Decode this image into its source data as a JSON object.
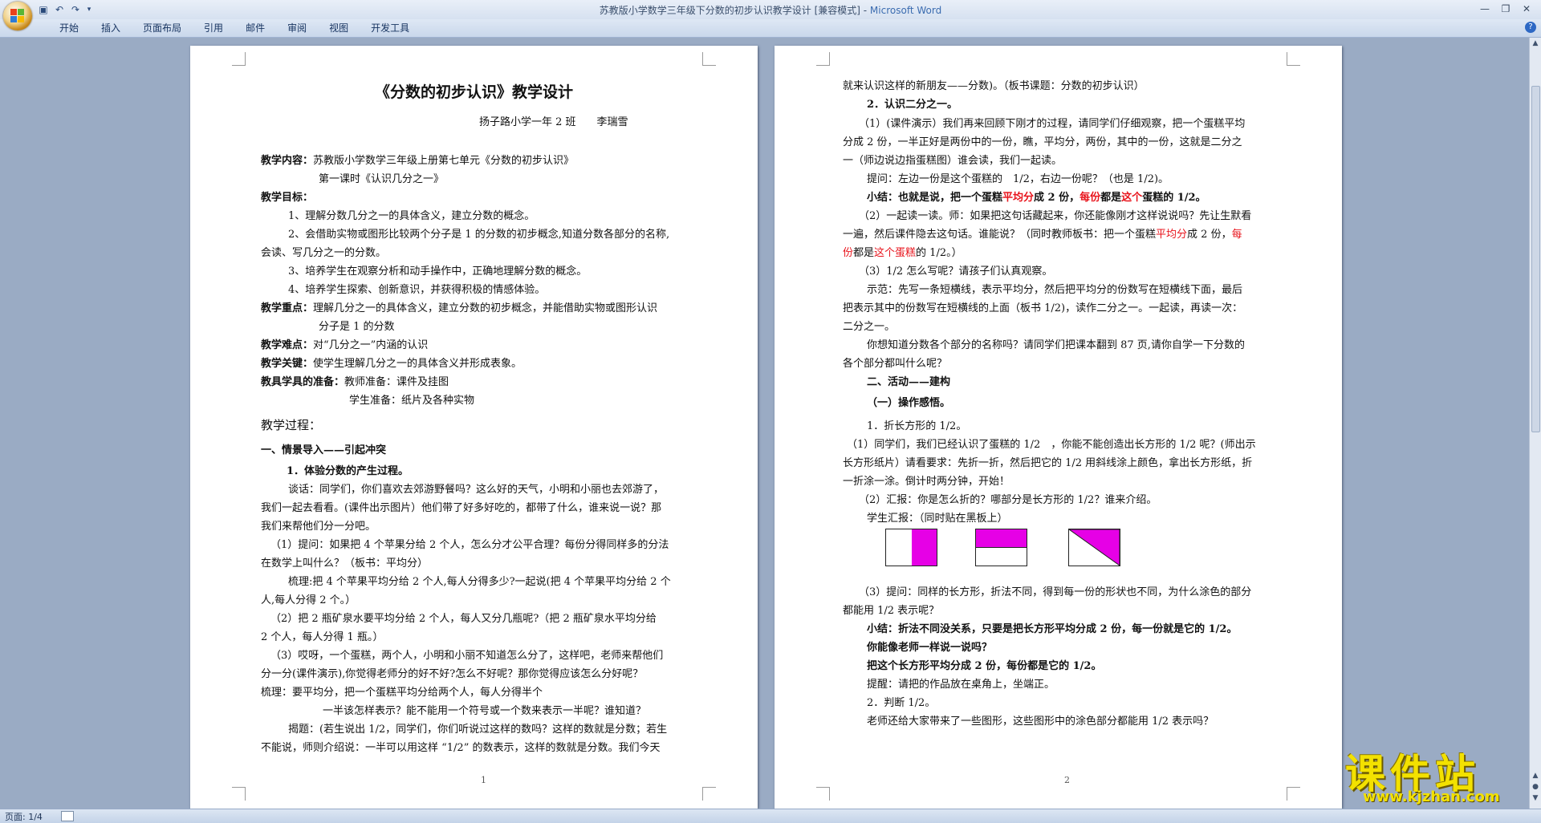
{
  "window": {
    "doc_name": "苏教版小学数学三年级下分数的初步认识教学设计 [兼容模式] - ",
    "app_name": "Microsoft Word"
  },
  "qat": {
    "save_icon": "save-icon",
    "undo_icon": "undo-icon",
    "redo_icon": "redo-icon"
  },
  "ribbon_tabs": [
    "开始",
    "插入",
    "页面布局",
    "引用",
    "邮件",
    "审阅",
    "视图",
    "开发工具"
  ],
  "statusbar": {
    "page_info": "页面: 1/4"
  },
  "page1": {
    "number": "1",
    "title": "《分数的初步认识》教学设计",
    "author": "扬子路小学一年 2 班　　李瑞雪",
    "lines": [
      {
        "label": "教学内容：",
        "text": "苏教版小学数学三年级上册第七单元《分数的初步认识》"
      },
      {
        "label": "",
        "text": "第一课时《认识几分之一》"
      },
      {
        "label": "教学目标：",
        "text": ""
      },
      {
        "label": "",
        "text": "1、理解分数几分之一的具体含义，建立分数的概念。"
      },
      {
        "label": "",
        "text": "2、会借助实物或图形比较两个分子是 1 的分数的初步概念,知道分数各部分的名称,"
      },
      {
        "label": "",
        "text": "会读、写几分之一的分数。"
      },
      {
        "label": "",
        "text": "3、培养学生在观察分析和动手操作中，正确地理解分数的概念。"
      },
      {
        "label": "",
        "text": "4、培养学生探索、创新意识，并获得积极的情感体验。"
      },
      {
        "label": "教学重点：",
        "text": "理解几分之一的具体含义，建立分数的初步概念，并能借助实物或图形认识"
      },
      {
        "label": "",
        "text": "分子是 1 的分数"
      },
      {
        "label": "教学难点：",
        "text": "对“几分之一”内涵的认识"
      },
      {
        "label": "教学关键：",
        "text": "使学生理解几分之一的具体含义并形成表象。"
      },
      {
        "label": "教具学具的准备：",
        "text": "教师准备：课件及挂图"
      },
      {
        "label": "",
        "text": "学生准备：纸片及各种实物"
      },
      {
        "label": "",
        "text": "教学过程："
      },
      {
        "label": "",
        "text": "一、情景导入——引起冲突"
      },
      {
        "label": "",
        "text": "1．体验分数的产生过程。"
      },
      {
        "label": "",
        "text": "谈话：同学们，你们喜欢去郊游野餐吗？这么好的天气，小明和小丽也去郊游了，"
      },
      {
        "label": "",
        "text": "我们一起去看看。(课件出示图片）他们带了好多好吃的，都带了什么，谁来说一说？那"
      },
      {
        "label": "",
        "text": "我们来帮他们分一分吧。"
      },
      {
        "label": "",
        "text": "（1）提问：如果把 4 个苹果分给 2 个人，怎么分才公平合理？每份分得同样多的分法"
      },
      {
        "label": "",
        "text": "在数学上叫什么？（板书：平均分）"
      },
      {
        "label": "",
        "text": "梳理:把 4 个苹果平均分给 2 个人,每人分得多少?一起说(把 4 个苹果平均分给 2 个"
      },
      {
        "label": "",
        "text": "人,每人分得 2 个。）"
      },
      {
        "label": "",
        "text": "（2）把 2 瓶矿泉水要平均分给 2 个人，每人又分几瓶呢?（把 2 瓶矿泉水平均分给"
      },
      {
        "label": "",
        "text": "2 个人，每人分得 1 瓶。）"
      },
      {
        "label": "",
        "text": "（3）哎呀，一个蛋糕，两个人，小明和小丽不知道怎么分了，这样吧，老师来帮他们"
      },
      {
        "label": "",
        "text": "分一分(课件演示),你觉得老师分的好不好?怎么不好呢？那你觉得应该怎么分好呢？"
      },
      {
        "label": "",
        "text": "梳理：要平均分，把一个蛋糕平均分给两个人，每人分得半个"
      },
      {
        "label": "",
        "text": "一半该怎样表示？能不能用一个符号或一个数来表示一半呢？谁知道？"
      },
      {
        "label": "",
        "text": "揭题：(若生说出 1/2，同学们，你们听说过这样的数吗？这样的数就是分数；若生"
      },
      {
        "label": "",
        "text": "不能说，师则介绍说：一半可以用这样 “1/2” 的数表示，这样的数就是分数。我们今天"
      }
    ]
  },
  "page2": {
    "number": "2",
    "l1": "就来认识这样的新朋友——分数)。（板书课题：分数的初步认识）",
    "l2": "2．认识二分之一。",
    "l3": "（1）(课件演示）我们再来回顾下刚才的过程，请同学们仔细观察，把一个蛋糕平均",
    "l4": "分成 2 份，一半正好是两份中的一份，瞧，平均分，两份，其中的一份，这就是二分之",
    "l5": "一（师边说边指蛋糕图）谁会读，我们一起读。",
    "l6": "提问：左边一份是这个蛋糕的　1/2，右边一份呢？（也是 1/2)。",
    "l7a": "小结：也就是说，把一个蛋糕",
    "l7b": "平均分",
    "l7c": "成 2 份，",
    "l7d": "每份",
    "l7e": "都是",
    "l7f": "这个",
    "l7g": "蛋糕的 1/2。",
    "l8": "（2）一起读一读。师：如果把这句话藏起来，你还能像刚才这样说说吗？先让生默看",
    "l9a": "一遍，然后课件隐去这句话。谁能说？（同时教师板书：把一个蛋糕",
    "l9b": "平均分",
    "l9c": "成 2 份，",
    "l9d": "每",
    "l10a": "份",
    "l10b": "都是",
    "l10c": "这个蛋糕",
    "l10d": "的 1/2。）",
    "l11": "（3）1/2 怎么写呢？请孩子们认真观察。",
    "l12": "示范：先写一条短横线，表示平均分，然后把平均分的份数写在短横线下面，最后",
    "l13": "把表示其中的份数写在短横线的上面（板书 1/2)，读作二分之一。一起读，再读一次：",
    "l14": "二分之一。",
    "l15": "你想知道分数各个部分的名称吗？请同学们把课本翻到 87 页,请你自学一下分数的",
    "l16": "各个部分都叫什么呢？",
    "l17": "二、活动——建构",
    "l18": "（一）操作感悟。",
    "l19": "1．折长方形的 1/2。",
    "l20": "（1）同学们，我们已经认识了蛋糕的 1/2　，你能不能创造出长方形的 1/2 呢？(师出示",
    "l21": "长方形纸片）请看要求：先折一折，然后把它的 1/2 用斜线涂上颜色，拿出长方形纸，折",
    "l22": "一折涂一涂。倒计时两分钟，开始！",
    "l23": "（2）汇报：你是怎么折的？哪部分是长方形的 1/2？谁来介绍。",
    "l24": "学生汇报：（同时贴在黑板上）",
    "l25": "（3）提问：同样的长方形，折法不同，得到每一份的形状也不同，为什么涂色的部分",
    "l26": "都能用 1/2 表示呢？",
    "l27": "小结：折法不同没关系，只要是把长方形平均分成 2 份，每一份就是它的 1/2。",
    "l28": "你能像老师一样说一说吗？",
    "l29": "把这个长方形平均分成 2 份，每份都是它的 1/2。",
    "l30": "提醒：请把的作品放在桌角上，坐端正。",
    "l31": "2．判断 1/2。",
    "l32": "老师还给大家带来了一些图形，这些图形中的涂色部分都能用 1/2 表示吗？"
  },
  "watermark": {
    "cn": "课件站",
    "url": "www.kjzhan.com"
  },
  "colors": {
    "shade": "#e600e6",
    "emphasis": "#e8141c"
  }
}
